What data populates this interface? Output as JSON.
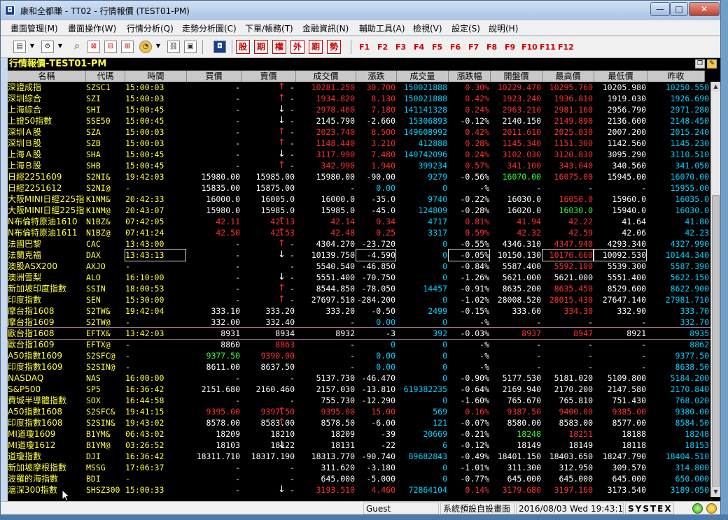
{
  "window": {
    "title": "康和全都賺 - TT02 - 行情報價 (TEST01-PM)",
    "icon": "app-logo-icon",
    "min_label": "—",
    "max_label": "□",
    "close_label": "✕"
  },
  "menu": [
    "畫面管理(M)",
    "畫面操作(W)",
    "行情分析(Q)",
    "走勢分析圖(C)",
    "下單/帳務(T)",
    "金融資訊(N)",
    "輔助工具(A)",
    "檢視(V)",
    "設定(S)",
    "說明(H)"
  ],
  "toolbar": {
    "red_buttons": [
      "股",
      "期",
      "權",
      "外",
      "期",
      "勢"
    ],
    "fkeys": [
      "F1",
      "F2",
      "F3",
      "F4",
      "F5",
      "F6",
      "F7",
      "F8",
      "F9",
      "F10",
      "F11",
      "F12"
    ]
  },
  "board": {
    "title": "行情報價-TEST01-PM",
    "columns": [
      "名稱",
      "代碼",
      "時間",
      "買價",
      "賣價",
      "成交價",
      "漲跌",
      "成交量",
      "漲跌幅",
      "開盤價",
      "最高價",
      "最低價",
      "昨收"
    ],
    "rows": [
      {
        "name": "深證成指",
        "code": "SZSC1",
        "time": "15:00:03",
        "bid": "-",
        "ask": "-",
        "arrow": "up",
        "last": "10281.250",
        "chg": "30.700",
        "vol": "150021888",
        "pct": "0.30%",
        "open": "10229.470",
        "high": "10295.760",
        "low": "10205.980",
        "prev": "10250.550",
        "c_last": "r",
        "c_chg": "r",
        "c_pct": "r",
        "c_open": "r",
        "c_high": "r",
        "c_low": "w"
      },
      {
        "name": "深圳綜合",
        "code": "SZI",
        "time": "15:00:03",
        "bid": "-",
        "ask": "-",
        "arrow": "up",
        "last": "1934.820",
        "chg": "8.130",
        "vol": "150021888",
        "pct": "0.42%",
        "open": "1923.240",
        "high": "1936.810",
        "low": "1919.030",
        "prev": "1926.690",
        "c_last": "r",
        "c_chg": "r",
        "c_pct": "r",
        "c_open": "r",
        "c_high": "r",
        "c_low": "w"
      },
      {
        "name": "上海綜合",
        "code": "SHI",
        "time": "15:00:45",
        "bid": "-",
        "ask": "-",
        "arrow": "down",
        "last": "2978.460",
        "chg": "7.180",
        "vol": "141141328",
        "pct": "0.24%",
        "open": "2963.210",
        "high": "2981.160",
        "low": "2956.790",
        "prev": "2971.280",
        "c_last": "r",
        "c_chg": "r",
        "c_pct": "r",
        "c_open": "r",
        "c_high": "r",
        "c_low": "w"
      },
      {
        "name": "上證50指數",
        "code": "SSE50",
        "time": "15:00:45",
        "bid": "-",
        "ask": "-",
        "arrow": "down",
        "last": "2145.790",
        "chg": "-2.660",
        "vol": "15306893",
        "pct": "-0.12%",
        "open": "2140.150",
        "high": "2149.890",
        "low": "2136.600",
        "prev": "2148.450",
        "c_last": "w",
        "c_chg": "w",
        "c_pct": "w",
        "c_open": "w",
        "c_high": "r",
        "c_low": "w"
      },
      {
        "name": "深圳Ａ股",
        "code": "SZA",
        "time": "15:00:03",
        "bid": "-",
        "ask": "-",
        "arrow": "up",
        "last": "2023.740",
        "chg": "8.500",
        "vol": "149608992",
        "pct": "0.42%",
        "open": "2011.610",
        "high": "2025.830",
        "low": "2007.200",
        "prev": "2015.240",
        "c_last": "r",
        "c_chg": "r",
        "c_pct": "r",
        "c_open": "r",
        "c_high": "r",
        "c_low": "w"
      },
      {
        "name": "深圳Ｂ股",
        "code": "SZB",
        "time": "15:00:03",
        "bid": "-",
        "ask": "-",
        "arrow": "up",
        "last": "1148.440",
        "chg": "3.210",
        "vol": "412888",
        "pct": "0.28%",
        "open": "1145.340",
        "high": "1151.300",
        "low": "1142.560",
        "prev": "1145.230",
        "c_last": "r",
        "c_chg": "r",
        "c_pct": "r",
        "c_open": "r",
        "c_high": "r",
        "c_low": "w"
      },
      {
        "name": "上海Ａ股",
        "code": "SHA",
        "time": "15:00:45",
        "bid": "-",
        "ask": "-",
        "arrow": "down",
        "last": "3117.990",
        "chg": "7.480",
        "vol": "140742096",
        "pct": "0.24%",
        "open": "3102.030",
        "high": "3120.830",
        "low": "3095.290",
        "prev": "3110.510",
        "c_last": "r",
        "c_chg": "r",
        "c_pct": "r",
        "c_open": "r",
        "c_high": "r",
        "c_low": "w"
      },
      {
        "name": "上海Ｂ股",
        "code": "SHB",
        "time": "15:00:45",
        "bid": "-",
        "ask": "-",
        "arrow": "up",
        "last": "342.990",
        "chg": "1.940",
        "vol": "399234",
        "pct": "0.57%",
        "open": "341.100",
        "high": "343.040",
        "low": "340.560",
        "prev": "341.050",
        "c_last": "r",
        "c_chg": "r",
        "c_pct": "r",
        "c_open": "r",
        "c_high": "r",
        "c_low": "w"
      },
      {
        "name": "日經2251609",
        "code": "S2NI&",
        "time": "19:42:03",
        "bid": "15980.00",
        "ask": "15985.00",
        "arrow": "",
        "last": "15980.00",
        "chg": "-90.00",
        "vol": "9279",
        "pct": "-0.56%",
        "open": "16070.00",
        "high": "16075.00",
        "low": "15945.00",
        "prev": "16070.00",
        "c_last": "w",
        "c_chg": "w",
        "c_pct": "w",
        "c_open": "g",
        "c_high": "r",
        "c_low": "w"
      },
      {
        "name": "日經2251612",
        "code": "S2NI@",
        "time": "-",
        "bid": "15835.00",
        "ask": "15875.00",
        "arrow": "",
        "last": "-",
        "chg": "0.00",
        "vol": "0",
        "pct": "-%",
        "open": "-",
        "high": "-",
        "low": "-",
        "prev": "15955.00",
        "c_last": "w",
        "c_chg": "c",
        "c_pct": "w",
        "c_open": "w",
        "c_high": "w",
        "c_low": "w"
      },
      {
        "name": "大阪MINI日經225指",
        "code": "K1NM&",
        "time": "20:42:33",
        "bid": "16000.0",
        "ask": "16005.0",
        "arrow": "",
        "last": "16000.0",
        "chg": "-35.0",
        "vol": "9740",
        "pct": "-0.22%",
        "open": "16030.0",
        "high": "16050.0",
        "low": "15960.0",
        "prev": "16035.0",
        "c_last": "w",
        "c_chg": "w",
        "c_pct": "w",
        "c_open": "w",
        "c_high": "r",
        "c_low": "w"
      },
      {
        "name": "大阪MINI日經225指",
        "code": "K1NM@",
        "time": "20:43:07",
        "bid": "15980.0",
        "ask": "15985.0",
        "arrow": "",
        "last": "15985.0",
        "chg": "-45.0",
        "vol": "124809",
        "pct": "-0.28%",
        "open": "16020.0",
        "high": "16030.0",
        "low": "15940.0",
        "prev": "16030.0",
        "c_last": "w",
        "c_chg": "w",
        "c_pct": "w",
        "c_open": "w",
        "c_high": "g",
        "c_low": "w"
      },
      {
        "name": "N布倫特原油1610",
        "code": "N1BZ&",
        "time": "07:42:05",
        "bid": "42.11",
        "ask": "42.13",
        "arrow": "up",
        "last": "42.14",
        "chg": "0.34",
        "vol": "4717",
        "pct": "0.81%",
        "open": "41.94",
        "high": "42.22",
        "low": "41.64",
        "prev": "41.80",
        "c_last": "r",
        "c_chg": "r",
        "c_pct": "r",
        "c_open": "r",
        "c_high": "r",
        "c_low": "w",
        "c_bid": "r",
        "c_ask": "r"
      },
      {
        "name": "N布倫特原油1611",
        "code": "N1BZ@",
        "time": "07:41:24",
        "bid": "42.50",
        "ask": "42.53",
        "arrow": "up",
        "last": "42.48",
        "chg": "0.25",
        "vol": "3317",
        "pct": "0.59%",
        "open": "42.32",
        "high": "42.59",
        "low": "42.06",
        "prev": "42.23",
        "c_last": "r",
        "c_chg": "r",
        "c_pct": "r",
        "c_open": "r",
        "c_high": "r",
        "c_low": "w",
        "c_bid": "r",
        "c_ask": "r"
      },
      {
        "name": "法國巴黎",
        "code": "CAC",
        "time": "13:43:00",
        "bid": "-",
        "ask": "-",
        "arrow": "up",
        "last": "4304.270",
        "chg": "-23.720",
        "vol": "0",
        "pct": "-0.55%",
        "open": "4346.310",
        "high": "4347.940",
        "low": "4293.340",
        "prev": "4327.990",
        "c_last": "w",
        "c_chg": "w",
        "c_pct": "w",
        "c_open": "w",
        "c_high": "r",
        "c_low": "w"
      },
      {
        "name": "法蘭克福",
        "code": "DAX",
        "time": "13:43:13",
        "bid": "-",
        "ask": "-",
        "arrow": "down",
        "last": "10139.750",
        "chg": "-4.590",
        "vol": "0",
        "pct": "-0.05%",
        "open": "10150.130",
        "high": "10176.660",
        "low": "10092.530",
        "prev": "10144.340",
        "c_last": "w",
        "c_chg": "w",
        "c_pct": "w",
        "c_open": "w",
        "c_high": "r",
        "c_low": "w",
        "boxed": true
      },
      {
        "name": "澳股ASX200",
        "code": "AXJO",
        "time": "-",
        "bid": "-",
        "ask": "-",
        "arrow": "",
        "last": "5540.540",
        "chg": "-46.850",
        "vol": "0",
        "pct": "-0.84%",
        "open": "5587.400",
        "high": "5592.100",
        "low": "5539.300",
        "prev": "5587.390",
        "c_last": "w",
        "c_chg": "w",
        "c_pct": "w",
        "c_open": "w",
        "c_high": "r",
        "c_low": "w"
      },
      {
        "name": "澳洲雪梨",
        "code": "ALO",
        "time": "16:10:00",
        "bid": "-",
        "ask": "-",
        "arrow": "down",
        "last": "5551.400",
        "chg": "-70.750",
        "vol": "0",
        "pct": "-1.26%",
        "open": "5621.000",
        "high": "5621.000",
        "low": "5551.400",
        "prev": "5622.150",
        "c_last": "w",
        "c_chg": "w",
        "c_pct": "w",
        "c_open": "w",
        "c_high": "w",
        "c_low": "w"
      },
      {
        "name": "新加坡印度指數",
        "code": "SSIN",
        "time": "18:00:53",
        "bid": "-",
        "ask": "-",
        "arrow": "up",
        "last": "8544.850",
        "chg": "-78.050",
        "vol": "14457",
        "pct": "-0.91%",
        "open": "8635.200",
        "high": "8635.450",
        "low": "8529.600",
        "prev": "8622.900",
        "c_last": "w",
        "c_chg": "w",
        "c_pct": "w",
        "c_open": "w",
        "c_high": "r",
        "c_low": "w"
      },
      {
        "name": "印度指數",
        "code": "SEN",
        "time": "15:30:00",
        "bid": "-",
        "ask": "-",
        "arrow": "up",
        "last": "27697.510",
        "chg": "-284.200",
        "vol": "0",
        "pct": "-1.02%",
        "open": "28008.520",
        "high": "28015.430",
        "low": "27647.140",
        "prev": "27981.710",
        "c_last": "w",
        "c_chg": "w",
        "c_pct": "w",
        "c_open": "w",
        "c_high": "r",
        "c_low": "w"
      },
      {
        "name": "摩台指1608",
        "code": "S2TW&",
        "time": "19:42:04",
        "bid": "333.10",
        "ask": "333.20",
        "arrow": "",
        "last": "333.20",
        "chg": "-0.50",
        "vol": "2499",
        "pct": "-0.15%",
        "open": "333.60",
        "high": "334.30",
        "low": "332.90",
        "prev": "333.70",
        "c_last": "w",
        "c_chg": "w",
        "c_pct": "w",
        "c_open": "w",
        "c_high": "r",
        "c_low": "w"
      },
      {
        "name": "摩台指1609",
        "code": "S2TW@",
        "time": "-",
        "bid": "332.00",
        "ask": "332.40",
        "arrow": "",
        "last": "-",
        "chg": "0.00",
        "vol": "0",
        "pct": "-%",
        "open": "-",
        "high": "-",
        "low": "-",
        "prev": "332.70",
        "c_last": "w",
        "c_chg": "c",
        "c_pct": "w",
        "c_open": "w",
        "c_high": "w",
        "c_low": "w"
      },
      {
        "name": "歐台指1608",
        "code": "EFTX&",
        "time": "13:42:03",
        "bid": "8931",
        "ask": "8934",
        "arrow": "",
        "last": "8932",
        "chg": "-3",
        "vol": "392",
        "pct": "-0.03%",
        "open": "8937",
        "high": "8947",
        "low": "8921",
        "prev": "8935",
        "c_last": "w",
        "c_chg": "w",
        "c_pct": "w",
        "c_open": "r",
        "c_high": "r",
        "c_low": "w",
        "selected": true
      },
      {
        "name": "歐台指1609",
        "code": "EFTX@",
        "time": "-",
        "bid": "8860",
        "ask": "8863",
        "arrow": "",
        "last": "-",
        "chg": "0",
        "vol": "0",
        "pct": "-%",
        "open": "-",
        "high": "-",
        "low": "-",
        "prev": "8862",
        "c_last": "w",
        "c_chg": "c",
        "c_pct": "w",
        "c_open": "w",
        "c_high": "w",
        "c_low": "w",
        "c_ask": "r"
      },
      {
        "name": "A50指數1609",
        "code": "S2SFC@",
        "time": "-",
        "bid": "9377.50",
        "ask": "9390.00",
        "arrow": "",
        "last": "-",
        "chg": "0.00",
        "vol": "0",
        "pct": "-%",
        "open": "-",
        "high": "-",
        "low": "-",
        "prev": "9377.50",
        "c_last": "w",
        "c_chg": "c",
        "c_pct": "w",
        "c_open": "w",
        "c_high": "w",
        "c_low": "w",
        "c_bid": "g",
        "c_ask": "r"
      },
      {
        "name": "印度指數1609",
        "code": "S2SIN@",
        "time": "-",
        "bid": "8611.00",
        "ask": "8637.50",
        "arrow": "",
        "last": "-",
        "chg": "0.00",
        "vol": "0",
        "pct": "-%",
        "open": "-",
        "high": "-",
        "low": "-",
        "prev": "8638.50",
        "c_last": "w",
        "c_chg": "c",
        "c_pct": "w",
        "c_open": "w",
        "c_high": "w",
        "c_low": "w"
      },
      {
        "name": "NASDAQ",
        "code": "NAS",
        "time": "16:00:00",
        "bid": "-",
        "ask": "-",
        "arrow": "",
        "last": "5137.730",
        "chg": "-46.470",
        "vol": "0",
        "pct": "-0.90%",
        "open": "5177.530",
        "high": "5181.020",
        "low": "5109.800",
        "prev": "5184.200",
        "c_last": "w",
        "c_chg": "w",
        "c_pct": "w",
        "c_open": "w",
        "c_high": "w",
        "c_low": "w"
      },
      {
        "name": "S&P500",
        "code": "SP5",
        "time": "16:36:42",
        "bid": "2151.680",
        "ask": "2160.460",
        "arrow": "",
        "last": "2157.030",
        "chg": "-13.810",
        "vol": "619382235",
        "pct": "-0.64%",
        "open": "2169.940",
        "high": "2170.200",
        "low": "2147.580",
        "prev": "2170.840",
        "c_last": "w",
        "c_chg": "w",
        "c_pct": "w",
        "c_open": "w",
        "c_high": "w",
        "c_low": "w"
      },
      {
        "name": "費城半導體指數",
        "code": "SOX",
        "time": "16:44:58",
        "bid": "-",
        "ask": "-",
        "arrow": "",
        "last": "755.730",
        "chg": "-12.290",
        "vol": "0",
        "pct": "-1.60%",
        "open": "765.670",
        "high": "765.810",
        "low": "751.430",
        "prev": "768.020",
        "c_last": "w",
        "c_chg": "w",
        "c_pct": "w",
        "c_open": "w",
        "c_high": "w",
        "c_low": "w"
      },
      {
        "name": "A50指數1608",
        "code": "S2SFC&",
        "time": "19:41:15",
        "bid": "9395.00",
        "ask": "9397.50",
        "arrow": "up",
        "last": "9395.00",
        "chg": "15.00",
        "vol": "569",
        "pct": "0.16%",
        "open": "9387.50",
        "high": "9400.00",
        "low": "9385.00",
        "prev": "9380.00",
        "c_last": "r",
        "c_chg": "r",
        "c_pct": "r",
        "c_open": "r",
        "c_high": "r",
        "c_low": "r",
        "c_bid": "r",
        "c_ask": "r"
      },
      {
        "name": "印度指數1608",
        "code": "S2SIN&",
        "time": "19:43:02",
        "bid": "8578.00",
        "ask": "8583.00",
        "arrow": "up",
        "last": "8578.50",
        "chg": "-6.00",
        "vol": "121",
        "pct": "-0.07%",
        "open": "8580.00",
        "high": "8583.00",
        "low": "8577.00",
        "prev": "8584.50",
        "c_last": "w",
        "c_chg": "w",
        "c_pct": "w",
        "c_open": "w",
        "c_high": "w",
        "c_low": "w"
      },
      {
        "name": "MI道瓊1609",
        "code": "B1YM&",
        "time": "06:43:02",
        "bid": "18209",
        "ask": "18210",
        "arrow": "",
        "last": "18209",
        "chg": "-39",
        "vol": "20669",
        "pct": "-0.21%",
        "open": "18248",
        "high": "18251",
        "low": "18188",
        "prev": "18248",
        "c_last": "w",
        "c_chg": "w",
        "c_pct": "w",
        "c_open": "g",
        "c_high": "r",
        "c_low": "w"
      },
      {
        "name": "MI道瓊1612",
        "code": "B1YM@",
        "time": "03:26:52",
        "bid": "18103",
        "ask": "18122",
        "arrow": "down",
        "last": "18131",
        "chg": "-22",
        "vol": "6",
        "pct": "-0.12%",
        "open": "18149",
        "high": "18149",
        "low": "18118",
        "prev": "18153",
        "c_last": "w",
        "c_chg": "w",
        "c_pct": "w",
        "c_open": "w",
        "c_high": "w",
        "c_low": "w"
      },
      {
        "name": "道瓊指數",
        "code": "DJI",
        "time": "16:36:42",
        "bid": "18311.710",
        "ask": "18317.190",
        "arrow": "",
        "last": "18313.770",
        "chg": "-90.740",
        "vol": "89682843",
        "pct": "-0.49%",
        "open": "18401.150",
        "high": "18403.650",
        "low": "18247.790",
        "prev": "18404.510",
        "c_last": "w",
        "c_chg": "w",
        "c_pct": "w",
        "c_open": "w",
        "c_high": "w",
        "c_low": "w"
      },
      {
        "name": "新加坡摩根指數",
        "code": "MSSG",
        "time": "17:06:37",
        "bid": "-",
        "ask": "-",
        "arrow": "",
        "last": "311.620",
        "chg": "-3.180",
        "vol": "0",
        "pct": "-1.01%",
        "open": "311.300",
        "high": "312.950",
        "low": "309.570",
        "prev": "314.800",
        "c_last": "w",
        "c_chg": "w",
        "c_pct": "w",
        "c_open": "w",
        "c_high": "w",
        "c_low": "w"
      },
      {
        "name": "波羅的海指數",
        "code": "BDI",
        "time": "-",
        "bid": "-",
        "ask": "-",
        "arrow": "",
        "last": "645.000",
        "chg": "-5.000",
        "vol": "0",
        "pct": "-0.77%",
        "open": "645.000",
        "high": "645.000",
        "low": "645.000",
        "prev": "650.000",
        "c_last": "w",
        "c_chg": "w",
        "c_pct": "w",
        "c_open": "w",
        "c_high": "w",
        "c_low": "w"
      },
      {
        "name": "滬深300指數",
        "code": "SHSZ300",
        "time": "15:00:33",
        "bid": "-",
        "ask": "-",
        "arrow": "down",
        "last": "3193.510",
        "chg": "4.460",
        "vol": "72864104",
        "pct": "0.14%",
        "open": "3179.680",
        "high": "3197.160",
        "low": "3173.540",
        "prev": "3189.050",
        "c_last": "r",
        "c_chg": "r",
        "c_pct": "r",
        "c_open": "r",
        "c_high": "r",
        "c_low": "w"
      }
    ]
  },
  "status": {
    "user": "Guest",
    "layout": "系統預設自設畫面",
    "datetime": "2016/08/03 Wed 19:43:15",
    "brand": "SYSTEX"
  },
  "colors": {
    "r": "#ff3030",
    "g": "#30ff30",
    "w": "#ffffff",
    "c": "#00d0ff",
    "y": "#ffff3c"
  }
}
